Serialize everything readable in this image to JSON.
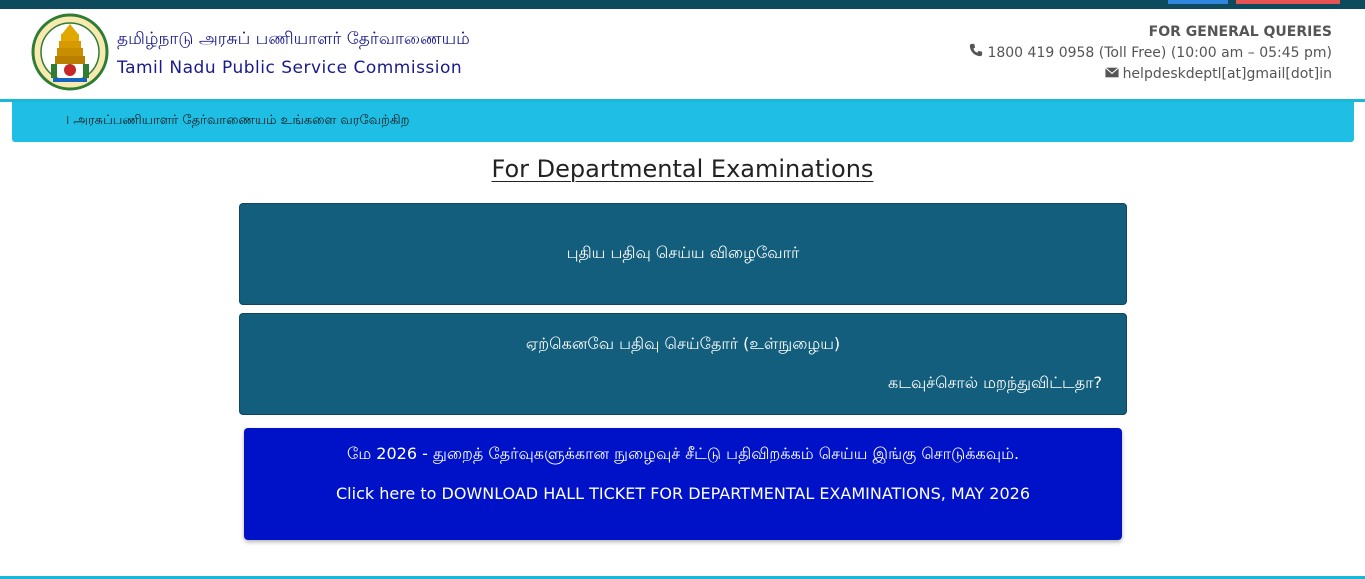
{
  "header": {
    "title_tamil": "தமிழ்நாடு அரசுப் பணியாளர் தேர்வாணையம்",
    "title_english": "Tamil Nadu Public Service Commission",
    "logo_icon": "tn-government-emblem-icon"
  },
  "contact": {
    "heading": "FOR GENERAL QUERIES",
    "phone": "1800 419 0958 (Toll Free) (10:00 am – 05:45 pm)",
    "email": "helpdeskdeptl[at]gmail[dot]in",
    "phone_icon": "phone-icon",
    "email_icon": "envelope-icon"
  },
  "marquee": {
    "text": "। அரசுப்பணியாளர் தேர்வாணையம் உங்களை வரவேற்கிற"
  },
  "page_title": "For Departmental Examinations",
  "cards": {
    "register_label": "புதிய பதிவு செய்ய விழைவோர்",
    "login_label": "ஏற்கெனவே பதிவு செய்தோர் (உள்நுழைய)",
    "forgot_password": "கடவுச்சொல் மறந்துவிட்டதா?"
  },
  "hall_ticket": {
    "tamil": "மே 2026 - துறைத் தேர்வுகளுக்கான நுழைவுச் சீட்டு பதிவிறக்கம் செய்ய இங்கு சொடுக்கவும்.",
    "english": "Click here to DOWNLOAD HALL TICKET FOR DEPARTMENTAL EXAMINATIONS, MAY 2026"
  },
  "colors": {
    "brand_blue": "#1a1a8c",
    "card_bg": "#135e7d",
    "hall_ticket_bg": "#0012c8",
    "marquee_bg": "#1ebee5"
  }
}
